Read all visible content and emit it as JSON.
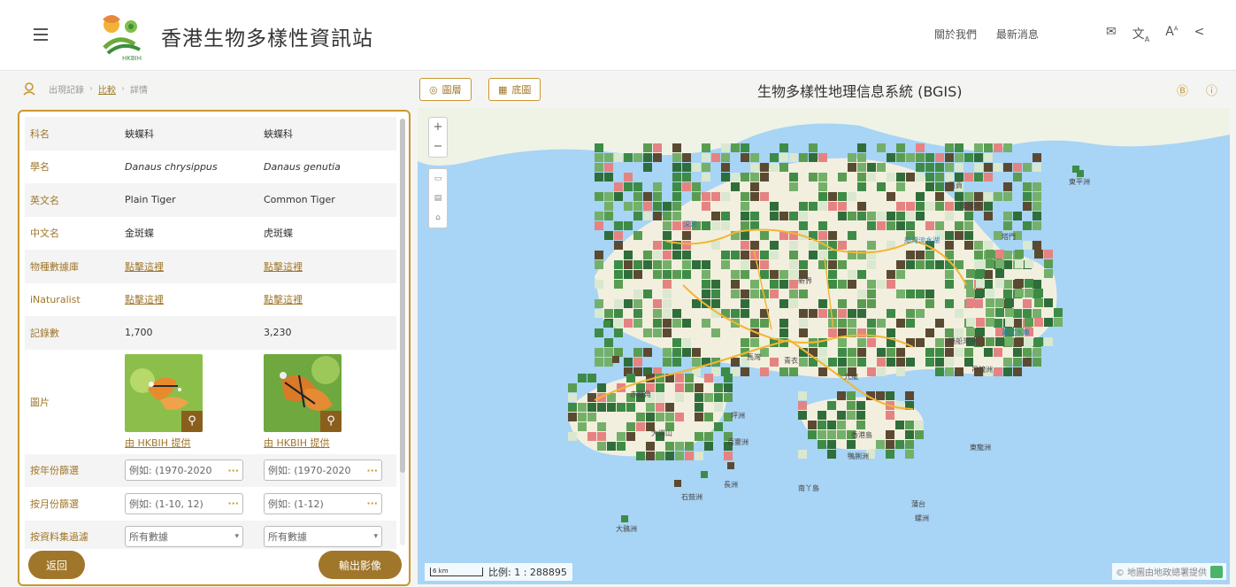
{
  "header": {
    "site_title": "香港生物多樣性資訊站",
    "logo_text": "HKBIH",
    "links": [
      "關於我們",
      "最新消息"
    ],
    "icons": [
      "mail-icon",
      "translate-icon",
      "font-size-icon",
      "share-icon"
    ]
  },
  "breadcrumb": {
    "items": [
      "出現記錄",
      "比較",
      "詳情"
    ]
  },
  "map_toolbar": {
    "layers_label": "圖層",
    "basemap_label": "底圖",
    "title": "生物多樣性地理信息系統 (BGIS)"
  },
  "compare": {
    "rows": [
      {
        "label": "科名",
        "a": "蛺蝶科",
        "b": "蛺蝶科"
      },
      {
        "label": "學名",
        "a": "Danaus chrysippus",
        "b": "Danaus genutia"
      },
      {
        "label": "英文名",
        "a": "Plain Tiger",
        "b": "Common Tiger"
      },
      {
        "label": "中文名",
        "a": "金斑蝶",
        "b": "虎斑蝶"
      },
      {
        "label": "物種數據庫",
        "a": "點擊這裡",
        "b": "點擊這裡"
      },
      {
        "label": "iNaturalist",
        "a": "點擊這裡",
        "b": "點擊這裡"
      },
      {
        "label": "記錄數",
        "a": "1,700",
        "b": "3,230"
      }
    ],
    "picture_label": "圖片",
    "credit_a": "由 HKBIH 提供",
    "credit_b": "由 HKBIH 提供",
    "filter_year_label": "按年份篩選",
    "filter_year_placeholder_a": "例如: (1970-2020",
    "filter_year_placeholder_b": "例如: (1970-2020",
    "filter_month_label": "按月份篩選",
    "filter_month_placeholder_a": "例如: (1-10, 12)",
    "filter_month_placeholder_b": "例如: (1-12)",
    "filter_dataset_label": "按資料集過濾",
    "dataset_value_a": "所有數據",
    "dataset_value_b": "所有數據"
  },
  "buttons": {
    "back": "返回",
    "export": "輸出影像"
  },
  "map": {
    "scale_bar_label": "6 km",
    "scale_text": "比例: 1 : 288895",
    "attribution": "© 地圖由地政總署提供",
    "places": [
      {
        "name": "西貢",
        "water": false
      },
      {
        "name": "東平洲",
        "water": false
      },
      {
        "name": "往灣洲",
        "water": false
      },
      {
        "name": "深灣",
        "water": true
      },
      {
        "name": "船灣淡水湖",
        "water": true
      },
      {
        "name": "塔門",
        "water": false
      },
      {
        "name": "新界",
        "water": false
      },
      {
        "name": "萬宜水庫",
        "water": true
      },
      {
        "name": "糧船灣洲",
        "water": false
      },
      {
        "name": "吊鐘洲",
        "water": false
      },
      {
        "name": "馬灣",
        "water": false
      },
      {
        "name": "青衣",
        "water": false
      },
      {
        "name": "赤鱲角",
        "water": false
      },
      {
        "name": "九龍",
        "water": false
      },
      {
        "name": "坪洲",
        "water": false
      },
      {
        "name": "大嶼山",
        "water": false
      },
      {
        "name": "喜靈洲",
        "water": false
      },
      {
        "name": "香港島",
        "water": false
      },
      {
        "name": "鴨脷洲",
        "water": false
      },
      {
        "name": "東龍洲",
        "water": false
      },
      {
        "name": "石鼓洲",
        "water": false
      },
      {
        "name": "長洲",
        "water": false
      },
      {
        "name": "南丫島",
        "water": false
      },
      {
        "name": "蒲台",
        "water": false
      },
      {
        "name": "螺洲",
        "water": false
      },
      {
        "name": "大鴉洲",
        "water": false
      }
    ]
  }
}
